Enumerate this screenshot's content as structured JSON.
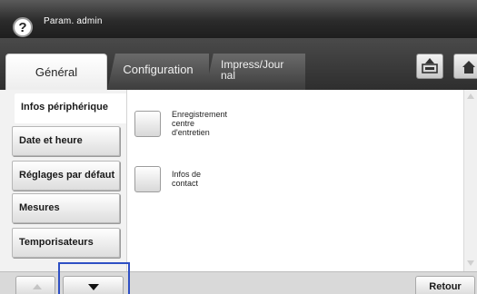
{
  "header": {
    "title": "Param. admin",
    "help_label": "?"
  },
  "tabs": [
    {
      "label": "Général",
      "active": true
    },
    {
      "label": "Configuration",
      "active": false
    },
    {
      "label_line1": "Impress/Jour",
      "label_line2": "nal",
      "active": false
    }
  ],
  "toolbar": {
    "icons": [
      "upload-tray-icon",
      "home-icon"
    ]
  },
  "sidebar": {
    "items": [
      {
        "label": "Infos périphérique",
        "selected": true
      },
      {
        "label": "Date et heure",
        "selected": false
      },
      {
        "label": "Réglages par défaut",
        "selected": false
      },
      {
        "label": "Mesures",
        "selected": false
      },
      {
        "label": "Temporisateurs",
        "selected": false
      }
    ]
  },
  "content": {
    "items": [
      {
        "lines": [
          "Enregistrement",
          "centre",
          "d'entretien"
        ]
      },
      {
        "lines": [
          "Infos de",
          "contact"
        ]
      }
    ]
  },
  "bottom": {
    "back_label": "Retour"
  },
  "colors": {
    "focus": "#2e4fc4",
    "title_bar": "#2b2b2b"
  }
}
